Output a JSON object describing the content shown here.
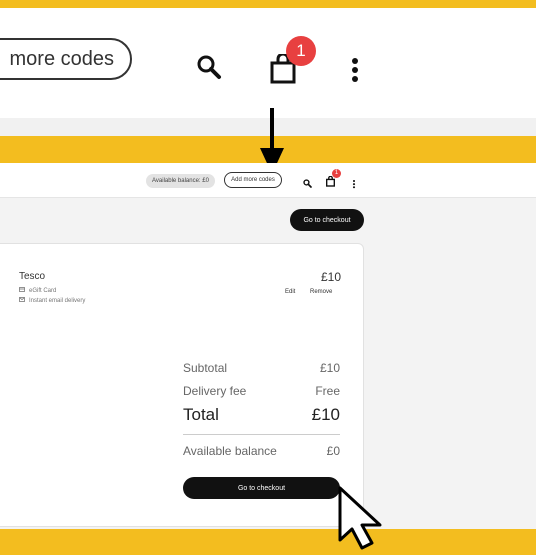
{
  "zoom": {
    "codes_label": "more codes",
    "badge_count": "1"
  },
  "topbar": {
    "balance_label": "Available balance: £0",
    "add_codes_label": "Add more codes",
    "badge_count": "1"
  },
  "checkout_top_label": "Go to checkout",
  "item": {
    "name": "Tesco",
    "price": "£10",
    "type": "eGift Card",
    "delivery": "Instant email delivery",
    "edit_label": "Edit",
    "remove_label": "Remove"
  },
  "summary": {
    "subtotal_label": "Subtotal",
    "subtotal_value": "£10",
    "delivery_label": "Delivery fee",
    "delivery_value": "Free",
    "total_label": "Total",
    "total_value": "£10",
    "balance_label": "Available balance",
    "balance_value": "£0",
    "checkout_label": "Go to checkout"
  },
  "colors": {
    "background": "#f3bd1f",
    "badge": "#e84040",
    "button": "#111111"
  },
  "icons": [
    "search-icon",
    "shopping-bag-icon",
    "more-vertical-icon",
    "down-arrow-icon",
    "cursor-icon",
    "card-icon",
    "mail-icon"
  ]
}
